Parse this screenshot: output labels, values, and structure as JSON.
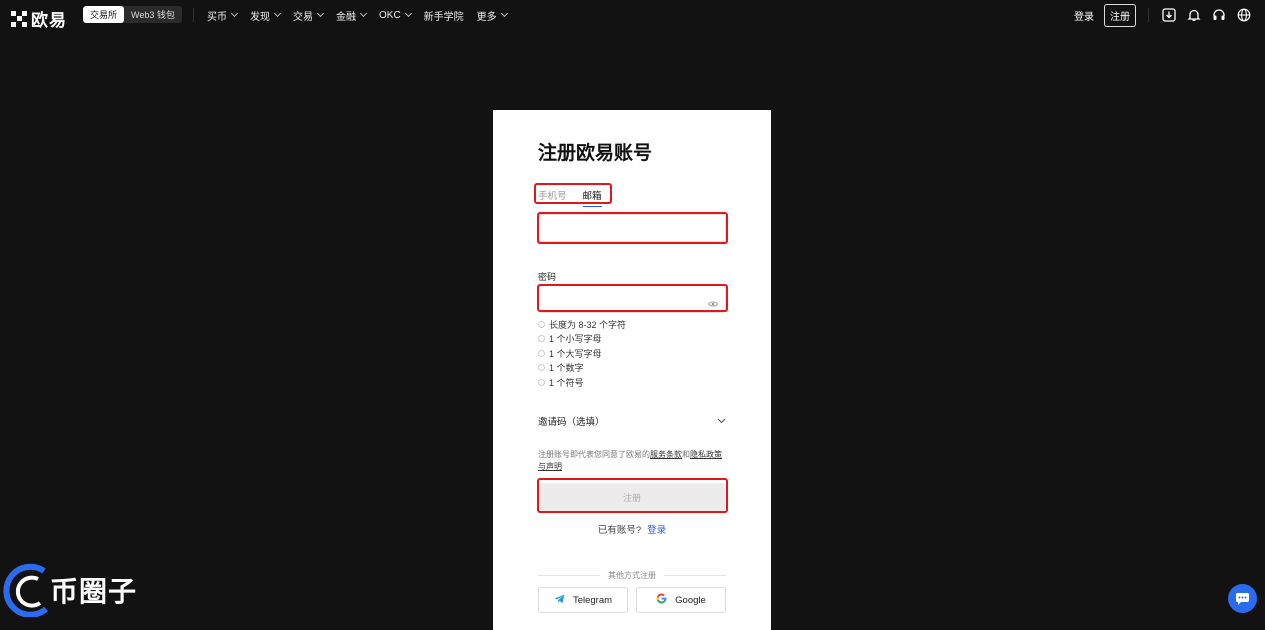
{
  "header": {
    "logo_text": "欧易",
    "switch": [
      "交易所",
      "Web3 钱包"
    ],
    "nav": [
      "买币",
      "发现",
      "交易",
      "金融",
      "OKC",
      "新手学院",
      "更多"
    ],
    "login": "登录",
    "register": "注册"
  },
  "form": {
    "title": "注册欧易账号",
    "tabs": [
      "手机号",
      "邮箱"
    ],
    "password_label": "密码",
    "rules": [
      "长度为 8-32 个字符",
      "1 个小写字母",
      "1 个大写字母",
      "1 个数字",
      "1 个符号"
    ],
    "invite_label": "邀请码（选填）",
    "terms_prefix": "注册账号即代表您同意了欧易的",
    "terms_link1": "服务条款",
    "terms_mid": "和",
    "terms_link2": "隐私政策与声明",
    "submit": "注册",
    "have_account": "已有账号?",
    "login_link": "登录",
    "other_methods": "其他方式注册",
    "telegram": "Telegram",
    "google": "Google"
  },
  "watermark": "币圈子",
  "colors": {
    "highlight": "#e3161a",
    "link": "#2c5cff"
  }
}
